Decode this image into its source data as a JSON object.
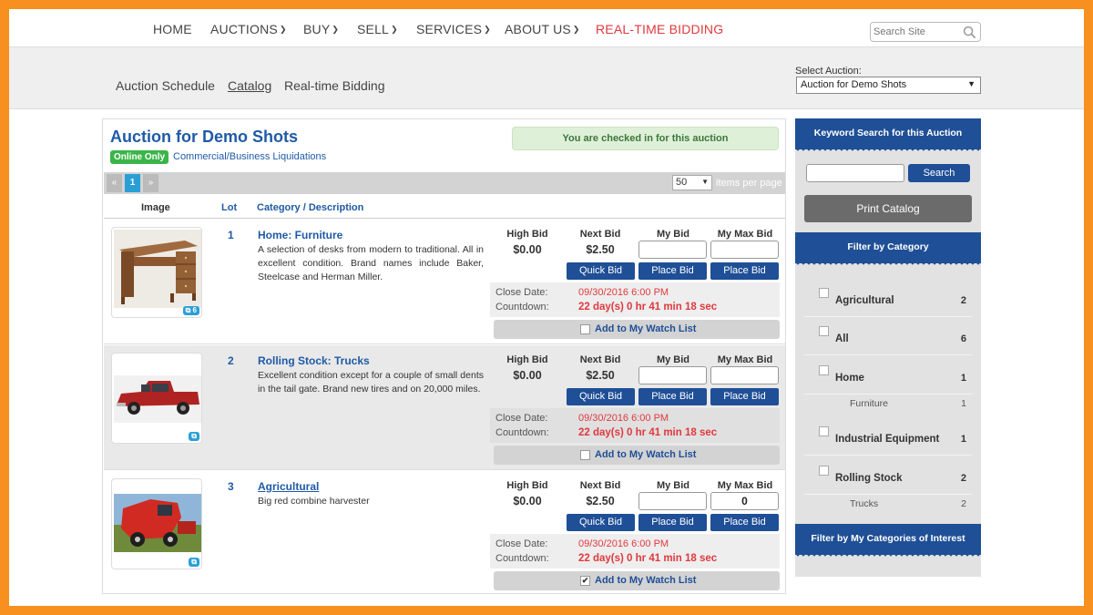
{
  "nav": {
    "items": [
      {
        "label": "HOME",
        "caret": false
      },
      {
        "label": "AUCTIONS",
        "caret": true
      },
      {
        "label": "BUY",
        "caret": true
      },
      {
        "label": "SELL",
        "caret": true
      },
      {
        "label": "SERVICES",
        "caret": true
      },
      {
        "label": "ABOUT US",
        "caret": true
      },
      {
        "label": "REAL-TIME BIDDING",
        "caret": false
      }
    ],
    "search_placeholder": "Search Site"
  },
  "subnav": {
    "items": [
      "Auction Schedule",
      "Catalog",
      "Real-time Bidding"
    ],
    "select_label": "Select Auction:",
    "select_value": "Auction for Demo Shots"
  },
  "auction": {
    "title": "Auction for Demo Shots",
    "badge": "Online Only",
    "type": "Commercial/Business Liquidations",
    "checked_in": "You are checked in for this auction"
  },
  "pager": {
    "prev": "«",
    "current": "1",
    "next": "»",
    "per_page": "50",
    "per_page_label": "items per page"
  },
  "columns": {
    "image": "Image",
    "lot": "Lot",
    "category": "Category / Description"
  },
  "bid_labels": {
    "high": "High Bid",
    "next": "Next Bid",
    "my": "My Bid",
    "max": "My Max Bid",
    "quick": "Quick Bid",
    "place": "Place Bid",
    "close": "Close Date:",
    "countdown": "Countdown:",
    "watch": "Add to My Watch List"
  },
  "lots": [
    {
      "lot": "1",
      "category": "Home: Furniture",
      "description": "A selection of desks from modern to traditional. All in excellent condition. Brand names include Baker, Steelcase and Herman Miller.",
      "image_count": "6",
      "high_bid": "$0.00",
      "next_bid": "$2.50",
      "my_bid": "",
      "my_max_bid": "",
      "close_date": "09/30/2016 6:00 PM",
      "countdown": "22 day(s) 0 hr 41 min 18 sec",
      "watched": false
    },
    {
      "lot": "2",
      "category": "Rolling Stock: Trucks",
      "description": "Excellent condition except for a couple of small dents in the tail gate. Brand new tires and on 20,000 miles.",
      "image_count": "",
      "high_bid": "$0.00",
      "next_bid": "$2.50",
      "my_bid": "",
      "my_max_bid": "",
      "close_date": "09/30/2016 6:00 PM",
      "countdown": "22 day(s) 0 hr 41 min 18 sec",
      "watched": false
    },
    {
      "lot": "3",
      "category": "Agricultural",
      "description": "Big red combine harvester",
      "image_count": "",
      "high_bid": "$0.00",
      "next_bid": "$2.50",
      "my_bid": "",
      "my_max_bid": "0",
      "close_date": "09/30/2016 6:00 PM",
      "countdown": "22 day(s) 0 hr 41 min 18 sec",
      "watched": true
    }
  ],
  "sidebar": {
    "keyword_title": "Keyword Search for this Auction",
    "search_button": "Search",
    "print_button": "Print Catalog",
    "filter_title": "Filter by Category",
    "categories": [
      {
        "name": "Agricultural",
        "count": "2"
      },
      {
        "name": "All",
        "count": "6"
      },
      {
        "name": "Home",
        "count": "1"
      },
      {
        "name": "Furniture",
        "count": "1"
      },
      {
        "name": "Industrial Equipment",
        "count": "1"
      },
      {
        "name": "Rolling Stock",
        "count": "2"
      },
      {
        "name": "Trucks",
        "count": "2"
      }
    ],
    "interest_title": "Filter by My Categories of Interest"
  },
  "colors": {
    "frame": "#f7901e",
    "brand_blue": "#1f4f96",
    "title_blue": "#1f5aa6",
    "alert_red": "#e0393e",
    "badge_green": "#3bb54a"
  }
}
